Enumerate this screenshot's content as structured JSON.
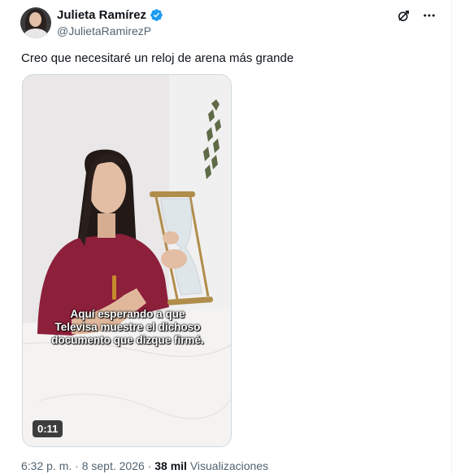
{
  "author": {
    "display_name": "Julieta Ramírez",
    "handle": "@JulietaRamirezP",
    "verified": true
  },
  "tweet": {
    "text": "Creo que necesitaré un reloj de arena más grande"
  },
  "video": {
    "caption_lines": [
      "Aquí esperando a que",
      "Televisa muestre el dichoso",
      "documento que dizque firmé."
    ],
    "duration": "0:11"
  },
  "meta": {
    "time": "6:32 p. m.",
    "separator": "·",
    "date": "8 sept. 2026",
    "views_count": "38 mil",
    "views_label": "Visualizaciones"
  },
  "icons": {
    "verified": "verified-badge-icon",
    "grok": "grok-icon",
    "more": "more-options-icon"
  },
  "colors": {
    "verified": "#1d9bf0",
    "text_primary": "#0f1419",
    "text_secondary": "#536471"
  }
}
